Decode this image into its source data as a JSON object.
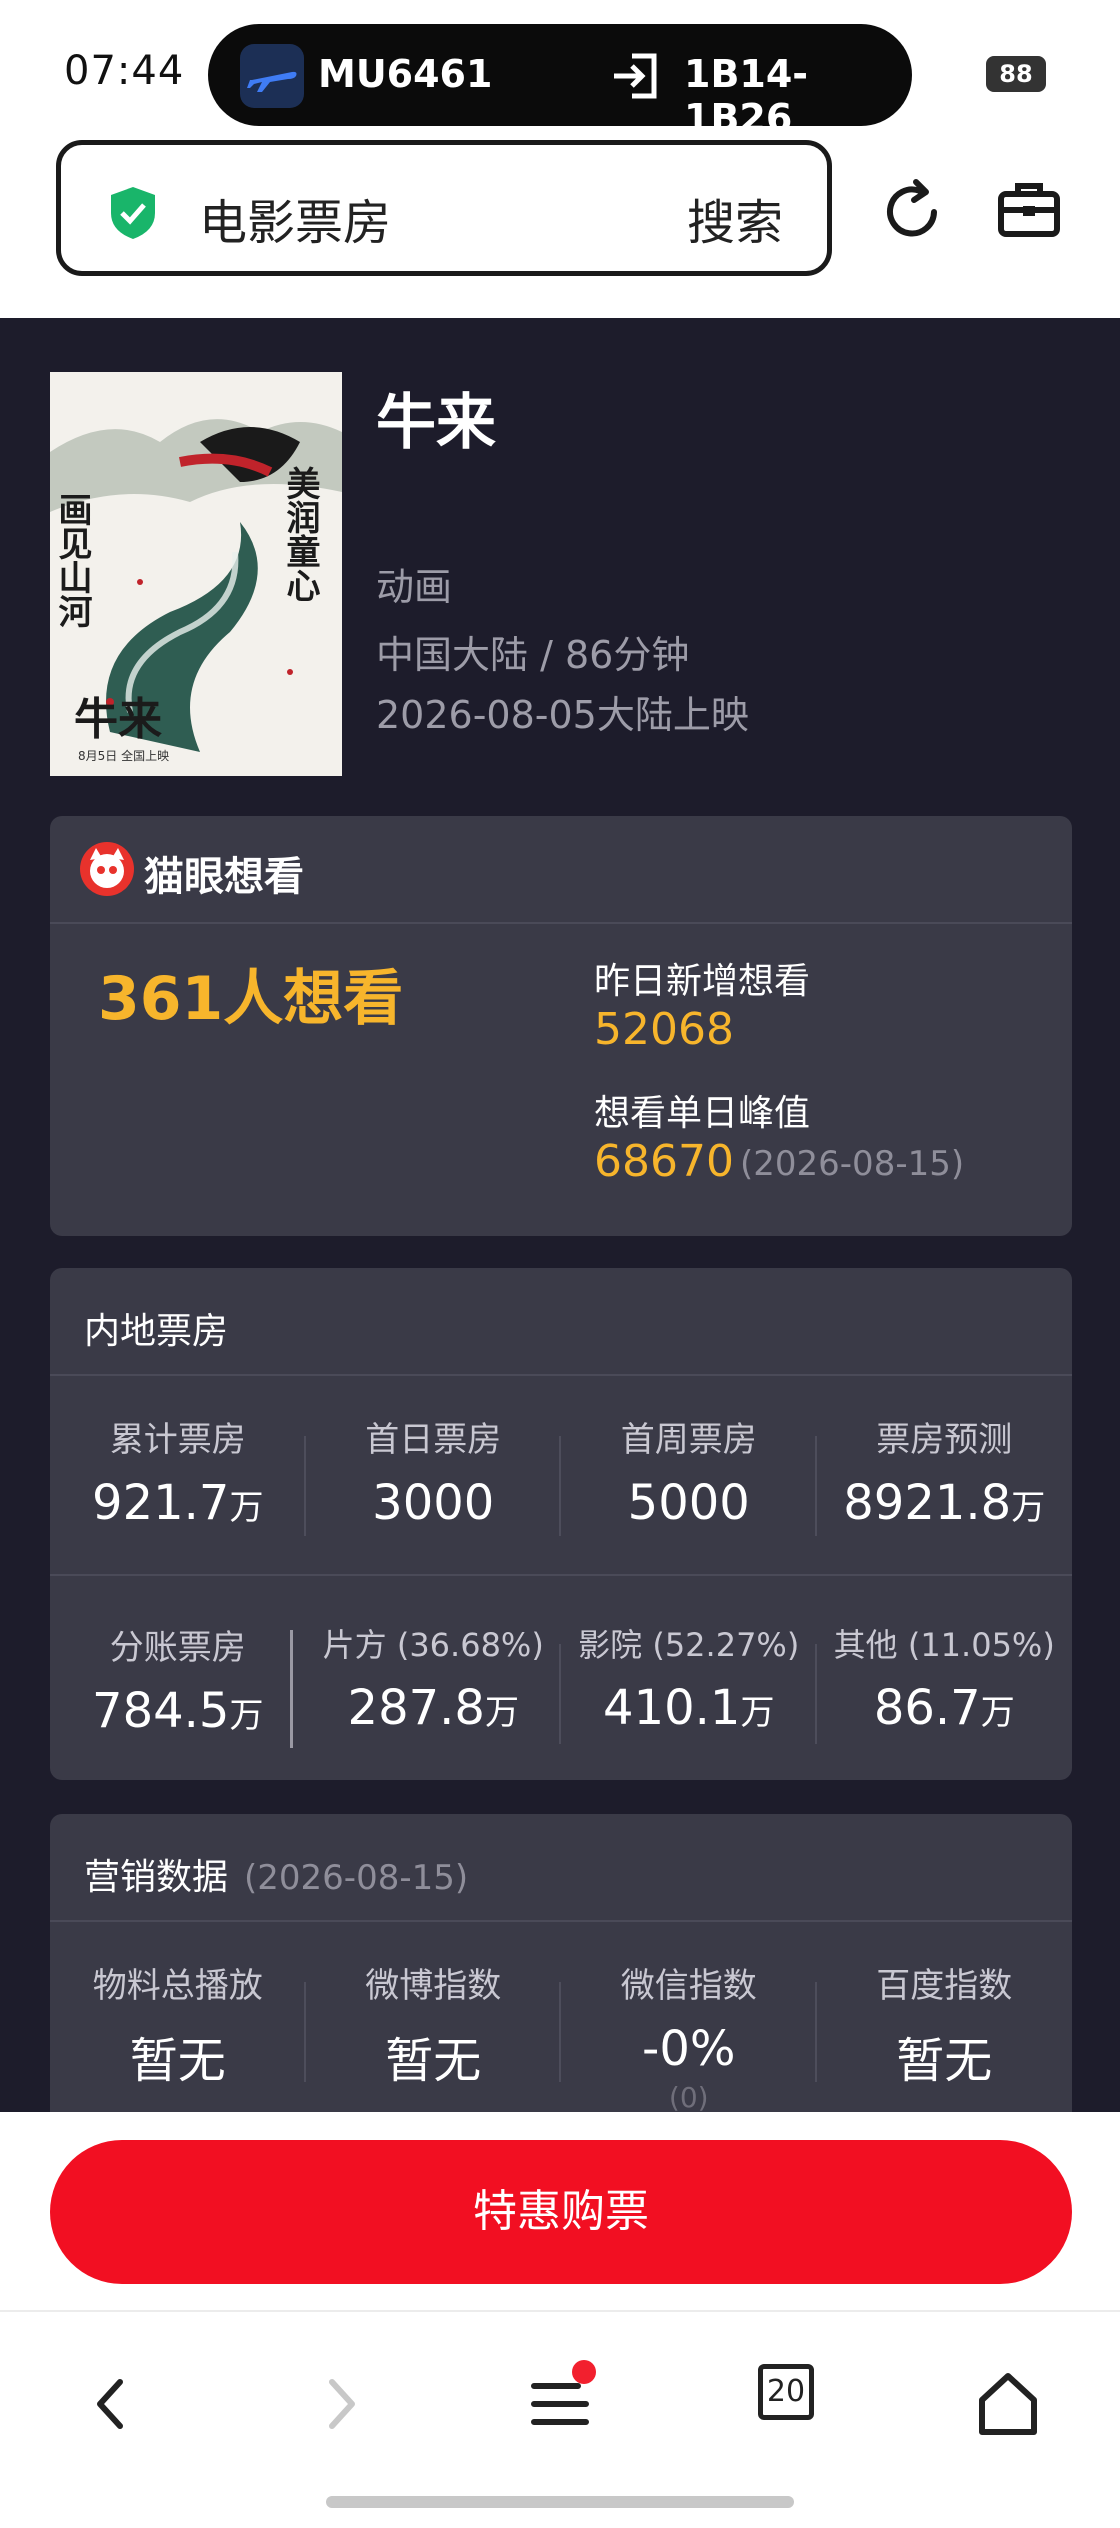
{
  "status": {
    "time": "07:44",
    "flight": "MU6461",
    "gate": "1B14-1B26",
    "battery": "88"
  },
  "addressbar": {
    "query": "电影票房",
    "search_label": "搜索"
  },
  "movie": {
    "title": "牛来",
    "genre": "动画",
    "region_duration": "中国大陆 / 86分钟",
    "release": "2026-08-05大陆上映",
    "poster": {
      "vertical_left": "画见山河",
      "vertical_right": "美润童心",
      "title": "牛来",
      "date_text": "8月5日 全国上映"
    }
  },
  "want": {
    "brand": "猫眼想看",
    "count_text": "361人想看",
    "yesterday_label": "昨日新增想看",
    "yesterday_value": "52068",
    "peak_label": "想看单日峰值",
    "peak_value": "68670",
    "peak_date": "(2026-08-15)"
  },
  "box_office": {
    "title": "内地票房",
    "row1": [
      {
        "label": "累计票房",
        "value": "921.7",
        "unit": "万"
      },
      {
        "label": "首日票房",
        "value": "3000",
        "unit": ""
      },
      {
        "label": "首周票房",
        "value": "5000",
        "unit": ""
      },
      {
        "label": "票房预测",
        "value": "8921.8",
        "unit": "万"
      }
    ],
    "row2": [
      {
        "label": "分账票房",
        "value": "784.5",
        "unit": "万"
      },
      {
        "label": "片方 (36.68%)",
        "value": "287.8",
        "unit": "万"
      },
      {
        "label": "影院 (52.27%)",
        "value": "410.1",
        "unit": "万"
      },
      {
        "label": "其他 (11.05%)",
        "value": "86.7",
        "unit": "万"
      }
    ]
  },
  "marketing": {
    "title": "营销数据",
    "date": "(2026-08-15)",
    "items": [
      {
        "label": "物料总播放",
        "value": "暂无",
        "sub": ""
      },
      {
        "label": "微博指数",
        "value": "暂无",
        "sub": ""
      },
      {
        "label": "微信指数",
        "value": "-0%",
        "sub": "(0)"
      },
      {
        "label": "百度指数",
        "value": "暂无",
        "sub": ""
      }
    ]
  },
  "buy_button": "特惠购票",
  "nav": {
    "tabs_count": "20"
  }
}
